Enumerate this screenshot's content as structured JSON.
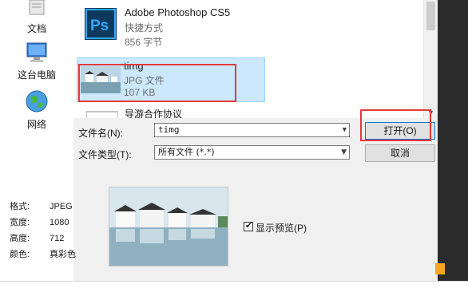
{
  "nav": {
    "items": [
      {
        "label": "文档",
        "icon": "documents-icon"
      },
      {
        "label": "这台电脑",
        "icon": "computer-icon"
      },
      {
        "label": "网络",
        "icon": "network-icon"
      }
    ]
  },
  "files": [
    {
      "name": "Adobe Photoshop CS5",
      "type": "快捷方式",
      "size": "856 字节",
      "icon": "photoshop-icon",
      "selected": false
    },
    {
      "name": "timg",
      "type": "JPG 文件",
      "size": "107 KB",
      "icon": "image-thumbnail",
      "selected": true
    },
    {
      "name": "导游合作协议",
      "type": "",
      "size": "",
      "icon": "document-icon",
      "selected": false
    }
  ],
  "form": {
    "filename_label": "文件名(N):",
    "filename_value": "timg",
    "filetype_label": "文件类型(T):",
    "filetype_value": "所有文件 (*.*)",
    "open_button": "打开(O)",
    "cancel_button": "取消"
  },
  "details": {
    "format_label": "格式:",
    "format_value": "JPEG",
    "width_label": "宽度:",
    "width_value": "1080",
    "height_label": "高度:",
    "height_value": "712",
    "color_label": "颜色:",
    "color_value": "真彩色",
    "show_preview_label": "显示预览(P)",
    "show_preview_checked": true
  },
  "colors": {
    "selection_bg": "#cce8ff",
    "annotation_red": "#e53935",
    "accent_blue": "#0078d7"
  }
}
